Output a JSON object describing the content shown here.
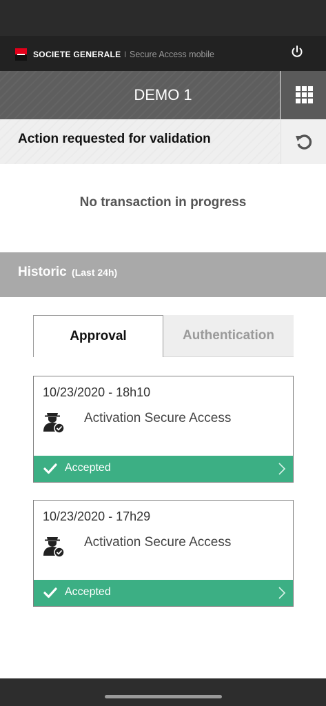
{
  "header": {
    "brand": "SOCIETE GENERALE",
    "separator": "I",
    "app_name": "Secure Access mobile",
    "power_icon": "power-icon"
  },
  "title_bar": {
    "title": "DEMO 1",
    "apps_icon": "apps-grid-icon"
  },
  "action_bar": {
    "label": "Action requested for validation",
    "refresh_icon": "refresh-icon"
  },
  "current": {
    "message": "No transaction in progress"
  },
  "historic": {
    "title": "Historic",
    "subtitle": "(Last 24h)"
  },
  "tabs": [
    {
      "label": "Approval",
      "active": true
    },
    {
      "label": "Authentication",
      "active": false
    }
  ],
  "transactions": [
    {
      "date": "10/23/2020 - 18h10",
      "title": "Activation Secure Access",
      "status": "Accepted",
      "icon": "agent-approved-icon"
    },
    {
      "date": "10/23/2020 - 17h29",
      "title": "Activation Secure Access",
      "status": "Accepted",
      "icon": "agent-approved-icon"
    }
  ],
  "colors": {
    "brand_red": "#e2001a",
    "header_dark": "#222222",
    "title_gray": "#5e5e5e",
    "historic_gray": "#a9a9a9",
    "accepted_green": "#3caf84"
  }
}
